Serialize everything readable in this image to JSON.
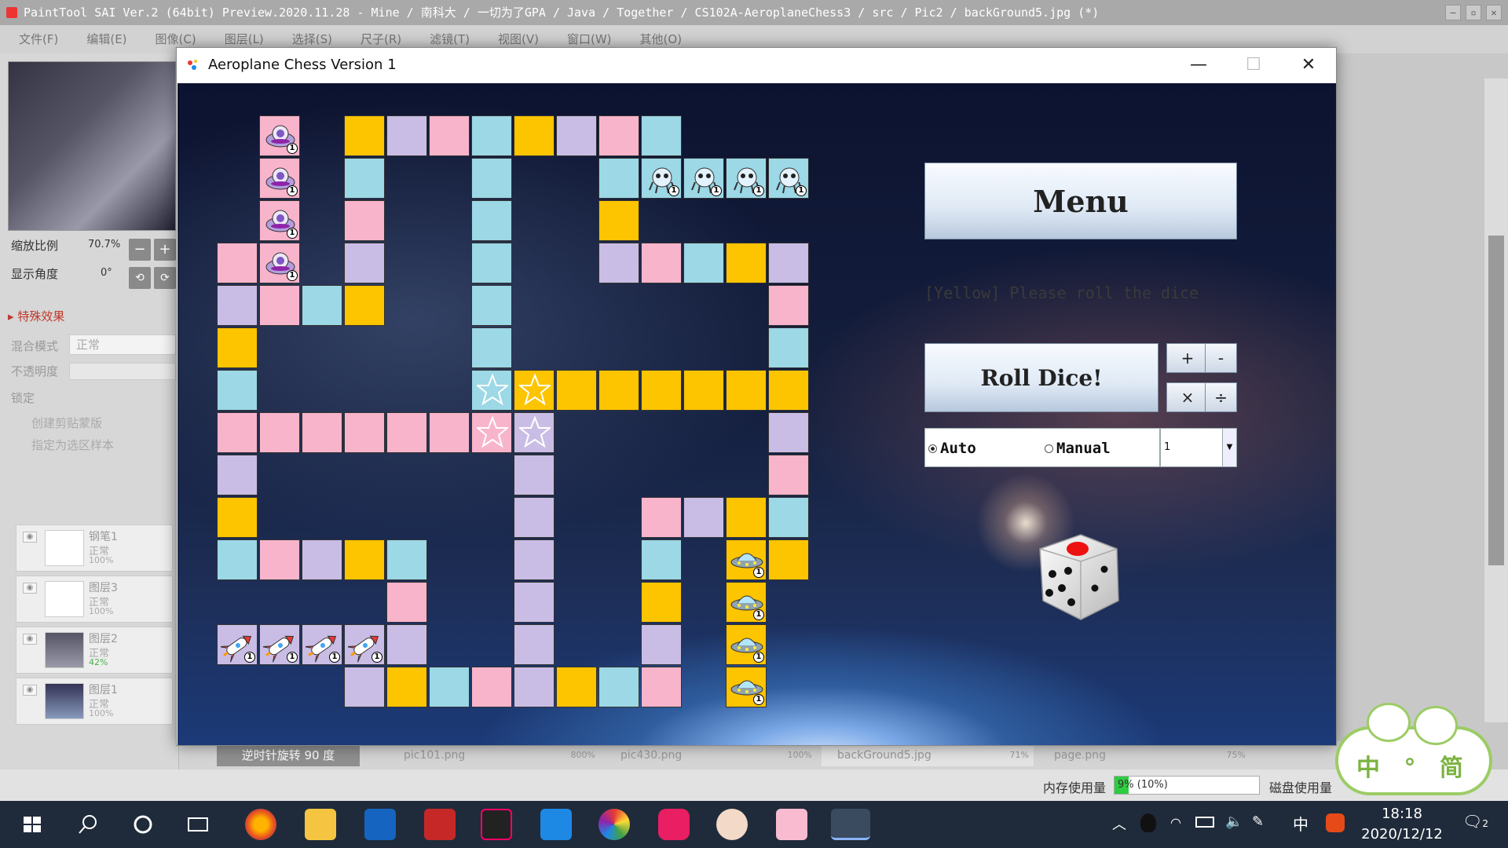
{
  "sai": {
    "title": "PaintTool SAI Ver.2 (64bit) Preview.2020.11.28 - Mine / 南科大 / 一切为了GPA / Java / Together / CS102A-AeroplaneChess3 / src / Pic2 / backGround5.jpg (*)",
    "menu": [
      "文件(F)",
      "编辑(E)",
      "图像(C)",
      "图层(L)",
      "选择(S)",
      "尺子(R)",
      "滤镜(T)",
      "视图(V)",
      "窗口(W)",
      "其他(O)"
    ],
    "zoom_label": "缩放比例",
    "zoom_value": "70.7%",
    "angle_label": "显示角度",
    "angle_value": "0°",
    "effects_label": "特殊效果",
    "blend_label": "混合模式",
    "blend_value": "正常",
    "opacity_label": "不透明度",
    "lock_label": "锁定",
    "clip_label": "创建剪贴蒙版",
    "sample_label": "指定为选区样本",
    "layers": [
      {
        "name": "钢笔1",
        "mode": "正常",
        "opacity": "100%"
      },
      {
        "name": "图层3",
        "mode": "正常",
        "opacity": "100%"
      },
      {
        "name": "图层2",
        "mode": "正常",
        "opacity": "42%"
      },
      {
        "name": "图层1",
        "mode": "正常",
        "opacity": "100%"
      }
    ],
    "rotate_button": "逆时针旋转 90 度",
    "file_tabs": [
      {
        "name": "pic101.png",
        "zoom": "800%"
      },
      {
        "name": "pic430.png",
        "zoom": "100%"
      },
      {
        "name": "backGround5.jpg",
        "zoom": "71%"
      },
      {
        "name": "page.png",
        "zoom": "75%"
      }
    ],
    "mem_label": "内存使用量",
    "mem_value": "9% (10%)",
    "disk_label": "磁盘使用量"
  },
  "window": {
    "title": "Aeroplane Chess Version 1",
    "minimize": "—",
    "maximize": "☐",
    "close": "✕"
  },
  "panel": {
    "menu_button": "Menu",
    "status": "[Yellow] Please roll the dice",
    "roll_button": "Roll Dice!",
    "ops": [
      "+",
      "-",
      "×",
      "÷"
    ],
    "mode_auto": "Auto",
    "mode_manual": "Manual",
    "selected_mode": "Auto",
    "dice_select": "1",
    "dice_value": 1
  },
  "piece_badge": "1",
  "taskbar": {
    "time": "18:18",
    "date": "2020/12/12",
    "ime": "中",
    "notifications": "2"
  },
  "sticker_text": "中 ° 简",
  "colors": {
    "pink": "#f8b4cb",
    "lavender": "#c9bde5",
    "blue": "#9cd8e6",
    "yellow": "#fdc400"
  }
}
